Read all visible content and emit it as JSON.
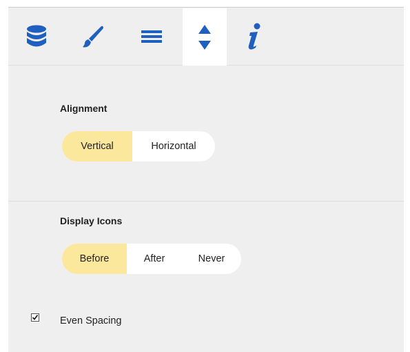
{
  "colors": {
    "accent_blue": "#1f5fbf",
    "selected_bg": "#fbe89d",
    "panel_bg": "#efefef"
  },
  "tabs": [
    {
      "icon": "database-icon",
      "active": false
    },
    {
      "icon": "brush-icon",
      "active": false
    },
    {
      "icon": "list-icon",
      "active": false
    },
    {
      "icon": "sort-icon",
      "active": true
    },
    {
      "icon": "info-icon",
      "active": false
    }
  ],
  "alignment": {
    "title": "Alignment",
    "options": [
      "Vertical",
      "Horizontal"
    ],
    "selected": "Vertical"
  },
  "display_icons": {
    "title": "Display Icons",
    "options": [
      "Before",
      "After",
      "Never"
    ],
    "selected": "Before"
  },
  "even_spacing": {
    "label": "Even Spacing",
    "checked": true
  }
}
